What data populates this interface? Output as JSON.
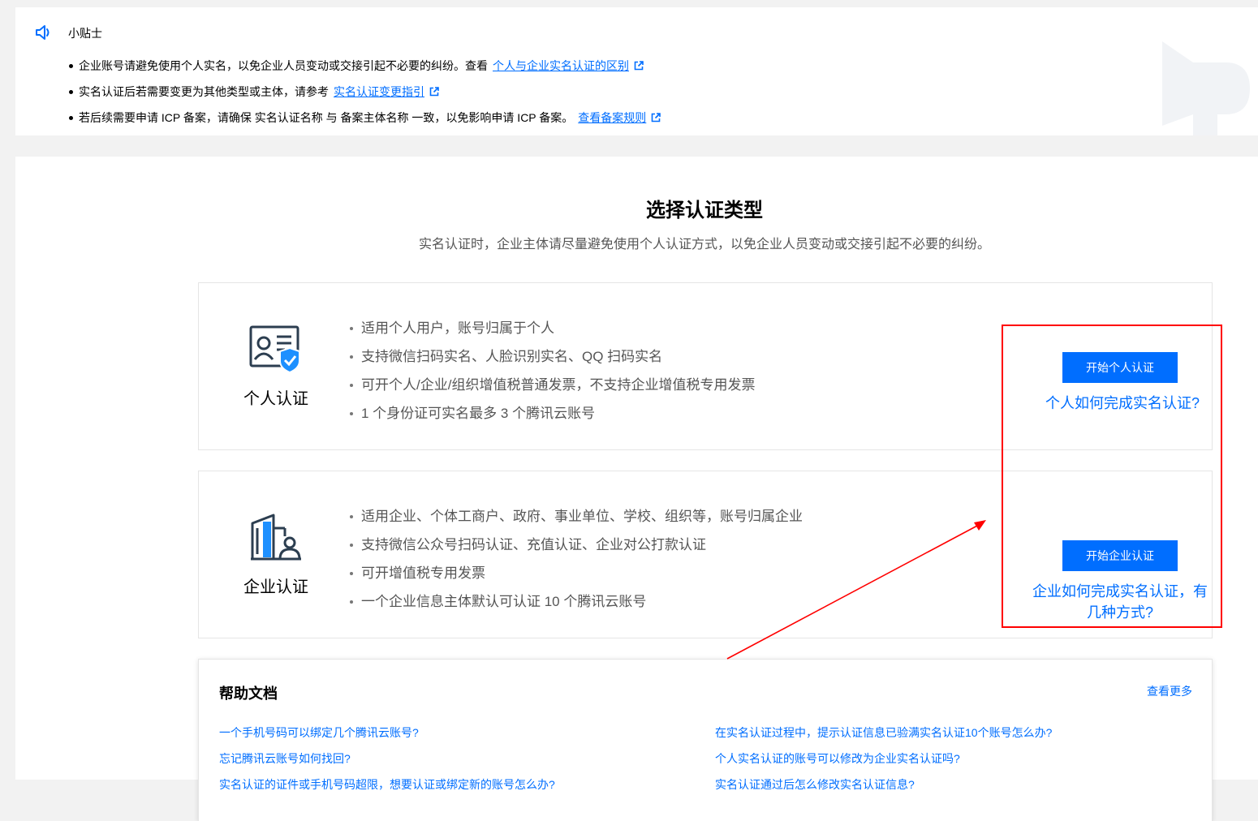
{
  "tips": {
    "title": "小贴士",
    "icons": {
      "speaker": "speaker-icon",
      "external": "external-link-icon"
    },
    "items": [
      {
        "text": "企业账号请避免使用个人实名，以免企业人员变动或交接引起不必要的纠纷。查看",
        "link": "个人与企业实名认证的区别"
      },
      {
        "text": "实名认证后若需要变更为其他类型或主体，请参考",
        "link": "实名认证变更指引"
      },
      {
        "text": "若后续需要申请 ICP 备案，请确保 实名认证名称 与 备案主体名称 一致，以免影响申请 ICP 备案。",
        "link": "查看备案规则"
      }
    ]
  },
  "main": {
    "title": "选择认证类型",
    "subtitle": "实名认证时，企业主体请尽量避免使用个人认证方式，以免企业人员变动或交接引起不必要的纠纷。",
    "personal": {
      "name": "个人认证",
      "features": [
        "适用个人用户，账号归属于个人",
        "支持微信扫码实名、人脸识别实名、QQ 扫码实名",
        "可开个人/企业/组织增值税普通发票，不支持企业增值税专用发票",
        "1 个身份证可实名最多 3 个腾讯云账号"
      ],
      "button": "开始个人认证",
      "help_link": "个人如何完成实名认证?"
    },
    "enterprise": {
      "name": "企业认证",
      "features": [
        "适用企业、个体工商户、政府、事业单位、学校、组织等，账号归属企业",
        "支持微信公众号扫码认证、充值认证、企业对公打款认证",
        "可开增值税专用发票",
        "一个企业信息主体默认可认证 10 个腾讯云账号"
      ],
      "button": "开始企业认证",
      "help_link_line1": "企业如何完成实名认证，有",
      "help_link_line2": "几种方式?"
    }
  },
  "docs": {
    "title": "帮助文档",
    "more": "查看更多",
    "left": [
      "一个手机号码可以绑定几个腾讯云账号?",
      "忘记腾讯云账号如何找回?",
      "实名认证的证件或手机号码超限，想要认证或绑定新的账号怎么办?"
    ],
    "right": [
      "在实名认证过程中，提示认证信息已验满实名认证10个账号怎么办?",
      "个人实名认证的账号可以修改为企业实名认证吗?",
      "实名认证通过后怎么修改实名认证信息?"
    ]
  },
  "colors": {
    "accent": "#006eff",
    "annotation": "#ff0000",
    "icon_dark": "#2c3e50"
  }
}
